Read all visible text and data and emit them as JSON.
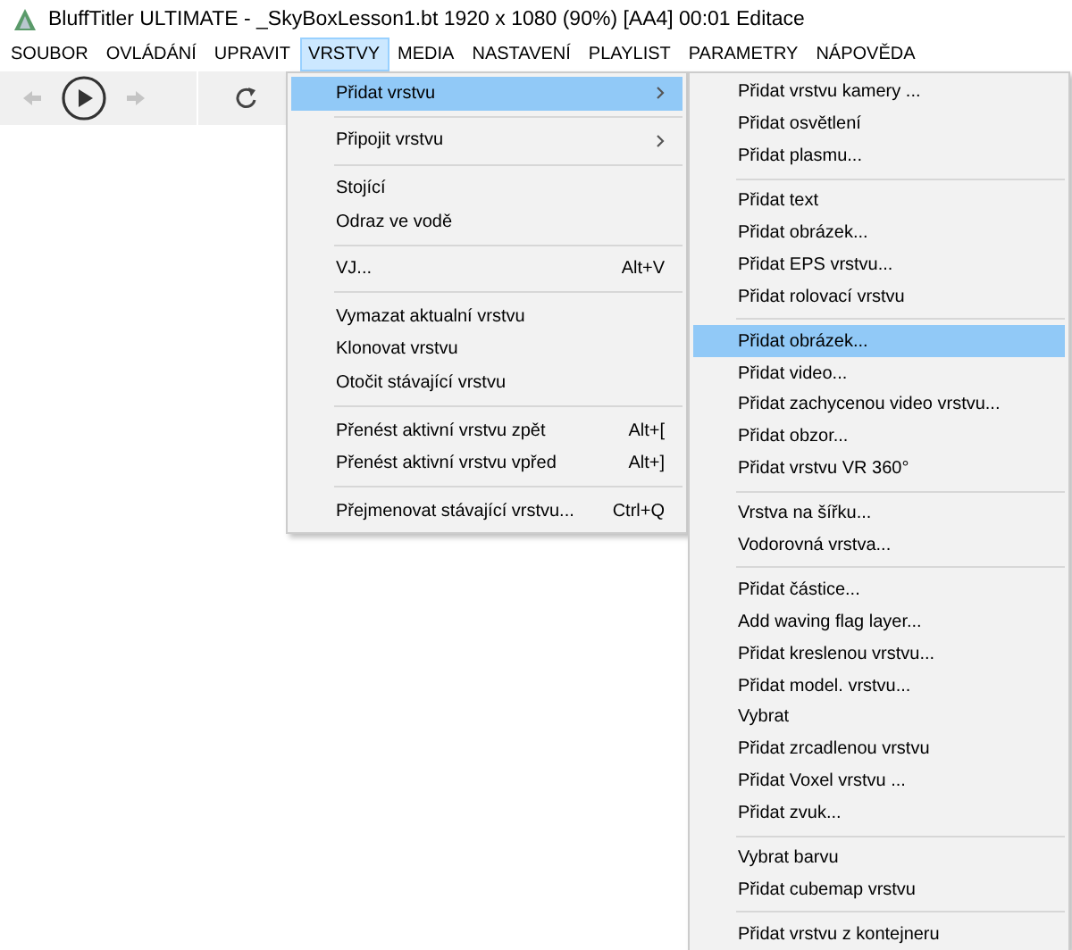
{
  "window": {
    "title": "BluffTitler ULTIMATE  - _SkyBoxLesson1.bt 1920 x 1080 (90%) [AA4] 00:01 Editace"
  },
  "menubar": [
    {
      "label": "SOUBOR",
      "selected": false
    },
    {
      "label": "OVLÁDÁNÍ",
      "selected": false
    },
    {
      "label": "UPRAVIT",
      "selected": false
    },
    {
      "label": "VRSTVY",
      "selected": true
    },
    {
      "label": "MEDIA",
      "selected": false
    },
    {
      "label": "NASTAVENÍ",
      "selected": false
    },
    {
      "label": "PLAYLIST",
      "selected": false
    },
    {
      "label": "PARAMETRY",
      "selected": false
    },
    {
      "label": "NÁPOVĚDA",
      "selected": false
    }
  ],
  "toolbar": {
    "back_disabled": true,
    "forward_disabled": true
  },
  "menu": {
    "groups": [
      [
        {
          "label": "Přidat vrstvu",
          "submenu": true,
          "selected": true
        }
      ],
      [
        {
          "label": "Připojit vrstvu",
          "submenu": true,
          "selected": false
        }
      ],
      [
        {
          "label": "Stojící",
          "selected": false
        },
        {
          "label": "Odraz ve vodě",
          "selected": false
        }
      ],
      [
        {
          "label": "VJ...",
          "shortcut": "Alt+V",
          "selected": false
        }
      ],
      [
        {
          "label": "Vymazat aktualní vrstvu",
          "selected": false
        },
        {
          "label": "Klonovat vrstvu",
          "selected": false
        },
        {
          "label": "Otočit stávající vrstvu",
          "selected": false
        }
      ],
      [
        {
          "label": "Přenést aktivní vrstvu zpět",
          "shortcut": "Alt+[",
          "selected": false
        },
        {
          "label": "Přenést aktivní vrstvu vpřed",
          "shortcut": "Alt+]",
          "selected": false
        }
      ],
      [
        {
          "label": "Přejmenovat stávající vrstvu...",
          "shortcut": "Ctrl+Q",
          "selected": false
        }
      ]
    ]
  },
  "submenu": {
    "groups": [
      [
        {
          "label": "Přidat vrstvu kamery ...",
          "selected": false
        },
        {
          "label": "Přidat osvětlení",
          "selected": false
        },
        {
          "label": "Přidat plasmu...",
          "selected": false
        }
      ],
      [
        {
          "label": "Přidat text",
          "selected": false
        },
        {
          "label": "Přidat obrázek...",
          "selected": false
        },
        {
          "label": "Přidat EPS vrstvu...",
          "selected": false
        },
        {
          "label": "Přidat rolovací vrstvu",
          "selected": false
        }
      ],
      [
        {
          "label": "Přidat obrázek...",
          "selected": true
        },
        {
          "label": "Přidat video...",
          "selected": false
        },
        {
          "label": "Přidat zachycenou video vrstvu...",
          "selected": false
        },
        {
          "label": "Přidat obzor...",
          "selected": false
        },
        {
          "label": "Přidat vrstvu VR 360°",
          "selected": false
        }
      ],
      [
        {
          "label": "Vrstva na šířku...",
          "selected": false
        },
        {
          "label": "Vodorovná vrstva...",
          "selected": false
        }
      ],
      [
        {
          "label": "Přidat částice...",
          "selected": false
        },
        {
          "label": "Add waving flag layer...",
          "selected": false
        },
        {
          "label": "Přidat kreslenou vrstvu...",
          "selected": false
        },
        {
          "label": "Přidat model. vrstvu...",
          "selected": false
        },
        {
          "label": "Vybrat",
          "selected": false
        },
        {
          "label": "Přidat zrcadlenou vrstvu",
          "selected": false
        },
        {
          "label": "Přidat Voxel vrstvu ...",
          "selected": false
        },
        {
          "label": "Přidat zvuk...",
          "selected": false
        }
      ],
      [
        {
          "label": "Vybrat barvu",
          "selected": false
        },
        {
          "label": "Přidat cubemap vrstvu",
          "selected": false
        }
      ],
      [
        {
          "label": "Přidat vrstvu z kontejneru",
          "selected": false
        }
      ]
    ]
  }
}
